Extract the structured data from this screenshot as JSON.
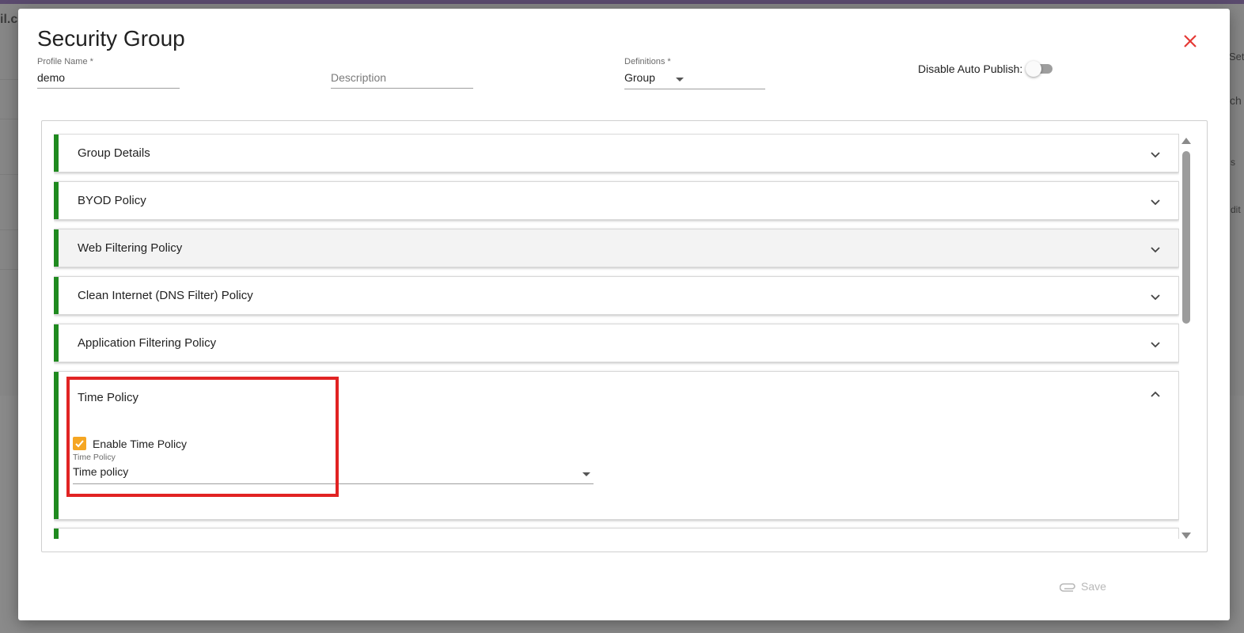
{
  "background": {
    "fragments": [
      "il.c",
      "Set",
      "ch",
      "s",
      "dit"
    ]
  },
  "modal": {
    "title": "Security Group",
    "close_icon": "close-icon",
    "profile_name": {
      "label": "Profile Name *",
      "value": "demo"
    },
    "description": {
      "label": "",
      "placeholder": "Description",
      "value": ""
    },
    "definitions": {
      "label": "Definitions *",
      "value": "Group"
    },
    "auto_publish": {
      "label": "Disable Auto Publish:",
      "enabled": false
    },
    "panels": [
      {
        "title": "Group Details",
        "expanded": false
      },
      {
        "title": "BYOD Policy",
        "expanded": false
      },
      {
        "title": "Web Filtering Policy",
        "expanded": false
      },
      {
        "title": "Clean Internet (DNS Filter) Policy",
        "expanded": false
      },
      {
        "title": "Application Filtering Policy",
        "expanded": false
      },
      {
        "title": "Time Policy",
        "expanded": true
      }
    ],
    "time_policy": {
      "checkbox_label": "Enable Time Policy",
      "checked": true,
      "select_label": "Time Policy",
      "select_value": "Time policy"
    },
    "save_label": "Save"
  },
  "colors": {
    "accent_green": "#1f8a1f",
    "checkbox_orange": "#f5a623",
    "close_red": "#e53935",
    "highlight_red": "#e12323"
  }
}
